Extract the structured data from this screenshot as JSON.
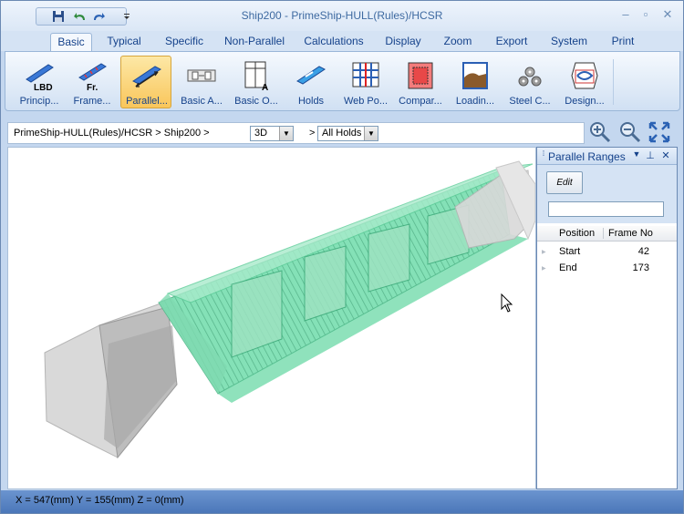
{
  "window": {
    "title": "Ship200 - PrimeShip-HULL(Rules)/HCSR"
  },
  "tabs": [
    {
      "label": "Basic",
      "active": true
    },
    {
      "label": "Typical"
    },
    {
      "label": "Specific"
    },
    {
      "label": "Non-Parallel"
    },
    {
      "label": "Calculations"
    },
    {
      "label": "Display"
    },
    {
      "label": "Zoom"
    },
    {
      "label": "Export"
    },
    {
      "label": "System"
    },
    {
      "label": "Print"
    }
  ],
  "ribbon": {
    "buttons": [
      {
        "label": "Princip...",
        "icon": "lbd-icon",
        "icon_text": "LBD"
      },
      {
        "label": "Frame...",
        "icon": "frame-icon",
        "icon_text": "Fr."
      },
      {
        "label": "Parallel...",
        "icon": "parallel-icon",
        "selected": true
      },
      {
        "label": "Basic A...",
        "icon": "basic-a-icon"
      },
      {
        "label": "Basic O...",
        "icon": "basic-o-icon",
        "icon_text": "A"
      },
      {
        "label": "Holds",
        "icon": "holds-icon"
      },
      {
        "label": "Web Po...",
        "icon": "web-position-icon"
      },
      {
        "label": "Compar...",
        "icon": "compartment-icon"
      },
      {
        "label": "Loadin...",
        "icon": "loading-icon"
      },
      {
        "label": "Steel C...",
        "icon": "steel-coil-icon"
      },
      {
        "label": "Design...",
        "icon": "design-icon"
      }
    ]
  },
  "pathbar": {
    "breadcrumb": "PrimeShip-HULL(Rules)/HCSR > Ship200 >",
    "view_mode": "3D",
    "separator": ">",
    "hold_filter": "All Holds"
  },
  "panel": {
    "title": "Parallel Ranges",
    "edit_label": "Edit",
    "columns": [
      "Position",
      "Frame No"
    ],
    "rows": [
      {
        "position": "Start",
        "frame": "42"
      },
      {
        "position": "End",
        "frame": "173"
      }
    ]
  },
  "status": {
    "coords": "X = 547(mm) Y = 155(mm) Z = 0(mm)"
  },
  "colors": {
    "hull_green": "#5fd6a0",
    "hull_gray": "#d4d4d4",
    "accent": "#4b77b9"
  }
}
